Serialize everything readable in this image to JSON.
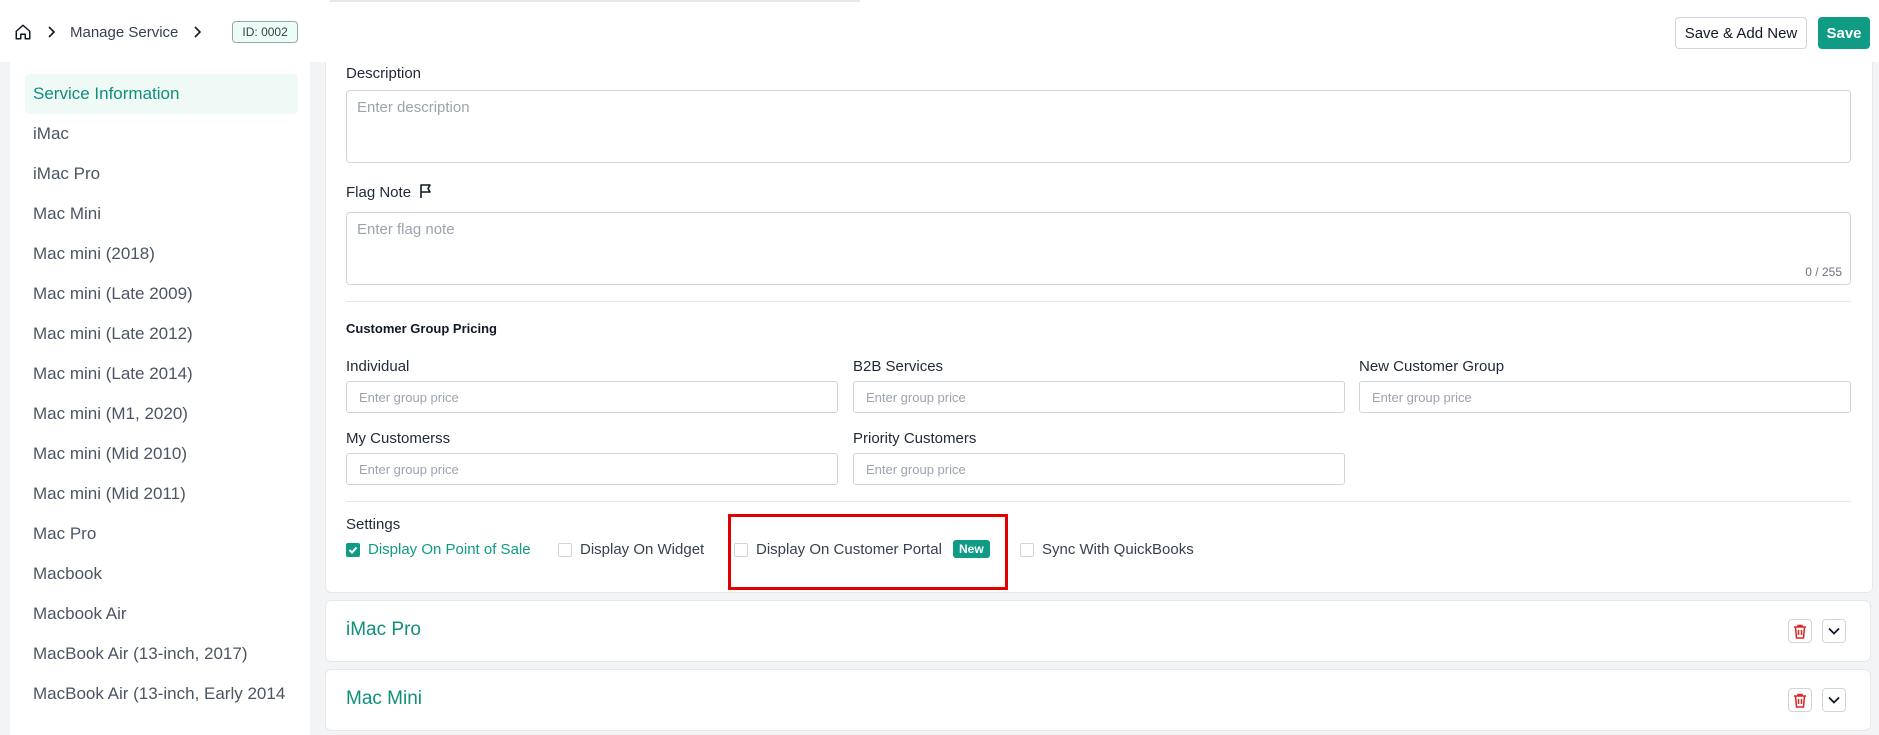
{
  "header": {
    "breadcrumb": {
      "section": "Manage Service",
      "id_badge": "ID: 0002"
    },
    "save_add_new_label": "Save & Add New",
    "save_label": "Save"
  },
  "sidebar": {
    "items": [
      {
        "label": "Service Information",
        "active": true
      },
      {
        "label": "iMac"
      },
      {
        "label": "iMac Pro"
      },
      {
        "label": "Mac Mini"
      },
      {
        "label": "Mac mini (2018)"
      },
      {
        "label": "Mac mini (Late 2009)"
      },
      {
        "label": "Mac mini (Late 2012)"
      },
      {
        "label": "Mac mini (Late 2014)"
      },
      {
        "label": "Mac mini (M1, 2020)"
      },
      {
        "label": "Mac mini (Mid 2010)"
      },
      {
        "label": "Mac mini (Mid 2011)"
      },
      {
        "label": "Mac Pro"
      },
      {
        "label": "Macbook"
      },
      {
        "label": "Macbook Air"
      },
      {
        "label": "MacBook Air (13-inch, 2017)"
      },
      {
        "label": "MacBook Air (13-inch, Early 2014"
      }
    ]
  },
  "form": {
    "description": {
      "label": "Description",
      "placeholder": "Enter description"
    },
    "flag_note": {
      "label": "Flag Note",
      "placeholder": "Enter flag note",
      "counter": "0 / 255"
    },
    "group_pricing": {
      "title": "Customer Group Pricing",
      "placeholder": "Enter group price",
      "fields": [
        {
          "label": "Individual"
        },
        {
          "label": "B2B Services"
        },
        {
          "label": "New Customer Group"
        },
        {
          "label": "My Customerss"
        },
        {
          "label": "Priority Customers"
        }
      ]
    },
    "settings": {
      "title": "Settings",
      "options": [
        {
          "label": "Display On Point of Sale",
          "checked": true
        },
        {
          "label": "Display On Widget",
          "checked": false
        },
        {
          "label": "Display On Customer Portal",
          "checked": false,
          "badge": "New"
        },
        {
          "label": "Sync With QuickBooks",
          "checked": false
        }
      ]
    }
  },
  "sections": [
    {
      "title": "iMac Pro"
    },
    {
      "title": "Mac Mini"
    }
  ],
  "colors": {
    "accent": "#0f9b84",
    "danger": "#dc2626",
    "highlight": "#e00000"
  }
}
